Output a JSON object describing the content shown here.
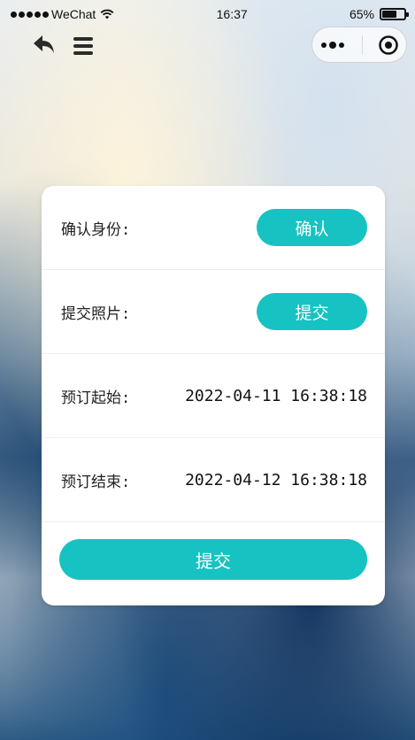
{
  "status_bar": {
    "carrier": "WeChat",
    "time": "16:37",
    "battery_percent": "65%",
    "battery_level": 0.65
  },
  "nav": {
    "back_icon": "back-arrow-icon",
    "menu_icon": "hamburger-menu-icon",
    "capsule_more_icon": "more-dots-icon",
    "capsule_close_icon": "target-circle-icon"
  },
  "form": {
    "rows": [
      {
        "label": "确认身份:",
        "button_label": "确认"
      },
      {
        "label": "提交照片:",
        "button_label": "提交"
      },
      {
        "label": "预订起始:",
        "value": "2022-04-11 16:38:18"
      },
      {
        "label": "预订结束:",
        "value": "2022-04-12 16:38:18"
      }
    ],
    "submit_label": "提交"
  },
  "colors": {
    "accent": "#17c2c2",
    "card": "#ffffff"
  }
}
